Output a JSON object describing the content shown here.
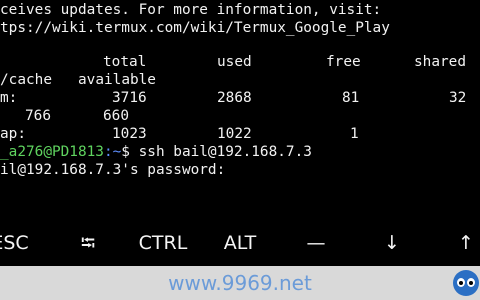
{
  "terminal": {
    "line1": "ceives updates. For more information, visit:",
    "line2": "tps://wiki.termux.com/wiki/Termux_Google_Play",
    "free_header": {
      "total": "total",
      "used": "used",
      "free": "free",
      "shared": "shared"
    },
    "free_header2": {
      "label": "/cache",
      "available": "available"
    },
    "mem_row": {
      "label": "m:",
      "total": "3716",
      "used": "2868",
      "free": "81",
      "shared": "32"
    },
    "mem_row2": {
      "cache": "766",
      "available": "660"
    },
    "swap_row": {
      "label": "ap:",
      "total": "1023",
      "used": "1022",
      "free": "1"
    },
    "prompt": {
      "user": "_a276@PD1813",
      "path": ":~",
      "command": "$ ssh bail@192.168.7.3"
    },
    "password_prompt": "il@192.168.7.3's password:"
  },
  "extra_keys": [
    {
      "label": "ESC",
      "icon": ""
    },
    {
      "label": "⭾",
      "icon": "tab-icon"
    },
    {
      "label": "CTRL",
      "icon": ""
    },
    {
      "label": "ALT",
      "icon": ""
    },
    {
      "label": "—",
      "icon": "dash-icon"
    },
    {
      "label": "↓",
      "icon": "arrow-down-icon"
    },
    {
      "label": "↑",
      "icon": "arrow-up-icon"
    }
  ],
  "watermark": "www.9969.net",
  "colors": {
    "background": "#000000",
    "text": "#f2f2f2",
    "user": "#5fd35f",
    "path": "#5f8fff",
    "bar": "#d9d9d9"
  }
}
